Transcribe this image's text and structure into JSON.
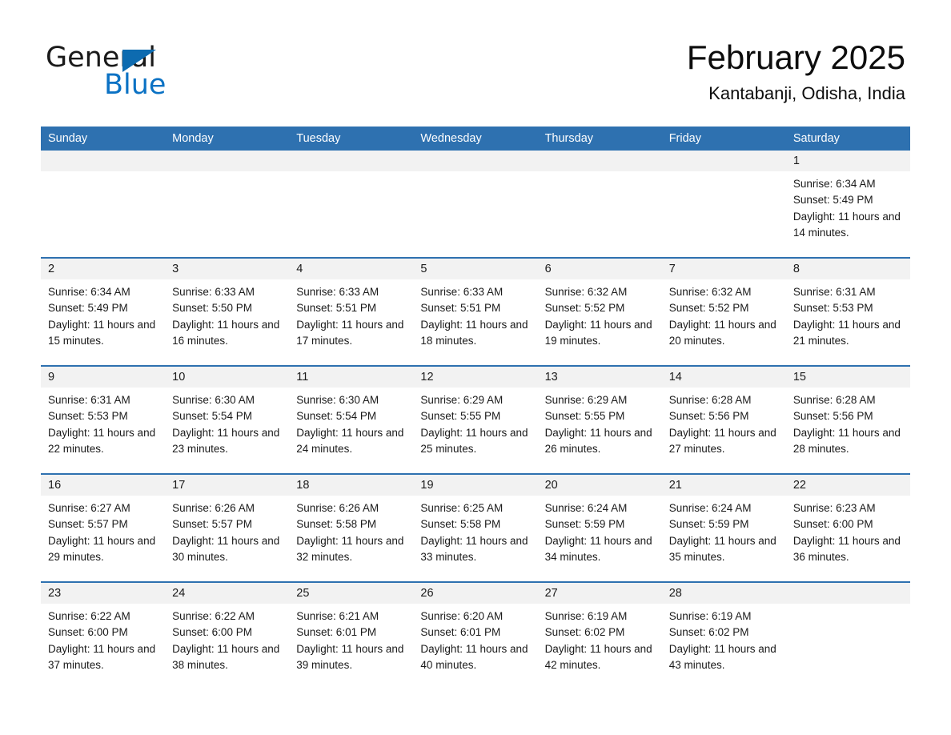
{
  "logo": {
    "word_one": "General",
    "word_two": "Blue",
    "triangle": "blue-triangle-icon",
    "accent_color": "#0b72c4"
  },
  "header": {
    "title": "February 2025",
    "location": "Kantabanji, Odisha, India"
  },
  "theme": {
    "header_row_bg": "#2e71b0",
    "daynum_bg": "#f2f2f2",
    "row_separator": "#2e71b0"
  },
  "calendar": {
    "day_headers": [
      "Sunday",
      "Monday",
      "Tuesday",
      "Wednesday",
      "Thursday",
      "Friday",
      "Saturday"
    ],
    "weeks": [
      [
        {
          "day": "",
          "sunrise": "",
          "sunset": "",
          "daylight": ""
        },
        {
          "day": "",
          "sunrise": "",
          "sunset": "",
          "daylight": ""
        },
        {
          "day": "",
          "sunrise": "",
          "sunset": "",
          "daylight": ""
        },
        {
          "day": "",
          "sunrise": "",
          "sunset": "",
          "daylight": ""
        },
        {
          "day": "",
          "sunrise": "",
          "sunset": "",
          "daylight": ""
        },
        {
          "day": "",
          "sunrise": "",
          "sunset": "",
          "daylight": ""
        },
        {
          "day": "1",
          "sunrise": "Sunrise: 6:34 AM",
          "sunset": "Sunset: 5:49 PM",
          "daylight": "Daylight: 11 hours and 14 minutes."
        }
      ],
      [
        {
          "day": "2",
          "sunrise": "Sunrise: 6:34 AM",
          "sunset": "Sunset: 5:49 PM",
          "daylight": "Daylight: 11 hours and 15 minutes."
        },
        {
          "day": "3",
          "sunrise": "Sunrise: 6:33 AM",
          "sunset": "Sunset: 5:50 PM",
          "daylight": "Daylight: 11 hours and 16 minutes."
        },
        {
          "day": "4",
          "sunrise": "Sunrise: 6:33 AM",
          "sunset": "Sunset: 5:51 PM",
          "daylight": "Daylight: 11 hours and 17 minutes."
        },
        {
          "day": "5",
          "sunrise": "Sunrise: 6:33 AM",
          "sunset": "Sunset: 5:51 PM",
          "daylight": "Daylight: 11 hours and 18 minutes."
        },
        {
          "day": "6",
          "sunrise": "Sunrise: 6:32 AM",
          "sunset": "Sunset: 5:52 PM",
          "daylight": "Daylight: 11 hours and 19 minutes."
        },
        {
          "day": "7",
          "sunrise": "Sunrise: 6:32 AM",
          "sunset": "Sunset: 5:52 PM",
          "daylight": "Daylight: 11 hours and 20 minutes."
        },
        {
          "day": "8",
          "sunrise": "Sunrise: 6:31 AM",
          "sunset": "Sunset: 5:53 PM",
          "daylight": "Daylight: 11 hours and 21 minutes."
        }
      ],
      [
        {
          "day": "9",
          "sunrise": "Sunrise: 6:31 AM",
          "sunset": "Sunset: 5:53 PM",
          "daylight": "Daylight: 11 hours and 22 minutes."
        },
        {
          "day": "10",
          "sunrise": "Sunrise: 6:30 AM",
          "sunset": "Sunset: 5:54 PM",
          "daylight": "Daylight: 11 hours and 23 minutes."
        },
        {
          "day": "11",
          "sunrise": "Sunrise: 6:30 AM",
          "sunset": "Sunset: 5:54 PM",
          "daylight": "Daylight: 11 hours and 24 minutes."
        },
        {
          "day": "12",
          "sunrise": "Sunrise: 6:29 AM",
          "sunset": "Sunset: 5:55 PM",
          "daylight": "Daylight: 11 hours and 25 minutes."
        },
        {
          "day": "13",
          "sunrise": "Sunrise: 6:29 AM",
          "sunset": "Sunset: 5:55 PM",
          "daylight": "Daylight: 11 hours and 26 minutes."
        },
        {
          "day": "14",
          "sunrise": "Sunrise: 6:28 AM",
          "sunset": "Sunset: 5:56 PM",
          "daylight": "Daylight: 11 hours and 27 minutes."
        },
        {
          "day": "15",
          "sunrise": "Sunrise: 6:28 AM",
          "sunset": "Sunset: 5:56 PM",
          "daylight": "Daylight: 11 hours and 28 minutes."
        }
      ],
      [
        {
          "day": "16",
          "sunrise": "Sunrise: 6:27 AM",
          "sunset": "Sunset: 5:57 PM",
          "daylight": "Daylight: 11 hours and 29 minutes."
        },
        {
          "day": "17",
          "sunrise": "Sunrise: 6:26 AM",
          "sunset": "Sunset: 5:57 PM",
          "daylight": "Daylight: 11 hours and 30 minutes."
        },
        {
          "day": "18",
          "sunrise": "Sunrise: 6:26 AM",
          "sunset": "Sunset: 5:58 PM",
          "daylight": "Daylight: 11 hours and 32 minutes."
        },
        {
          "day": "19",
          "sunrise": "Sunrise: 6:25 AM",
          "sunset": "Sunset: 5:58 PM",
          "daylight": "Daylight: 11 hours and 33 minutes."
        },
        {
          "day": "20",
          "sunrise": "Sunrise: 6:24 AM",
          "sunset": "Sunset: 5:59 PM",
          "daylight": "Daylight: 11 hours and 34 minutes."
        },
        {
          "day": "21",
          "sunrise": "Sunrise: 6:24 AM",
          "sunset": "Sunset: 5:59 PM",
          "daylight": "Daylight: 11 hours and 35 minutes."
        },
        {
          "day": "22",
          "sunrise": "Sunrise: 6:23 AM",
          "sunset": "Sunset: 6:00 PM",
          "daylight": "Daylight: 11 hours and 36 minutes."
        }
      ],
      [
        {
          "day": "23",
          "sunrise": "Sunrise: 6:22 AM",
          "sunset": "Sunset: 6:00 PM",
          "daylight": "Daylight: 11 hours and 37 minutes."
        },
        {
          "day": "24",
          "sunrise": "Sunrise: 6:22 AM",
          "sunset": "Sunset: 6:00 PM",
          "daylight": "Daylight: 11 hours and 38 minutes."
        },
        {
          "day": "25",
          "sunrise": "Sunrise: 6:21 AM",
          "sunset": "Sunset: 6:01 PM",
          "daylight": "Daylight: 11 hours and 39 minutes."
        },
        {
          "day": "26",
          "sunrise": "Sunrise: 6:20 AM",
          "sunset": "Sunset: 6:01 PM",
          "daylight": "Daylight: 11 hours and 40 minutes."
        },
        {
          "day": "27",
          "sunrise": "Sunrise: 6:19 AM",
          "sunset": "Sunset: 6:02 PM",
          "daylight": "Daylight: 11 hours and 42 minutes."
        },
        {
          "day": "28",
          "sunrise": "Sunrise: 6:19 AM",
          "sunset": "Sunset: 6:02 PM",
          "daylight": "Daylight: 11 hours and 43 minutes."
        },
        {
          "day": "",
          "sunrise": "",
          "sunset": "",
          "daylight": ""
        }
      ]
    ]
  }
}
